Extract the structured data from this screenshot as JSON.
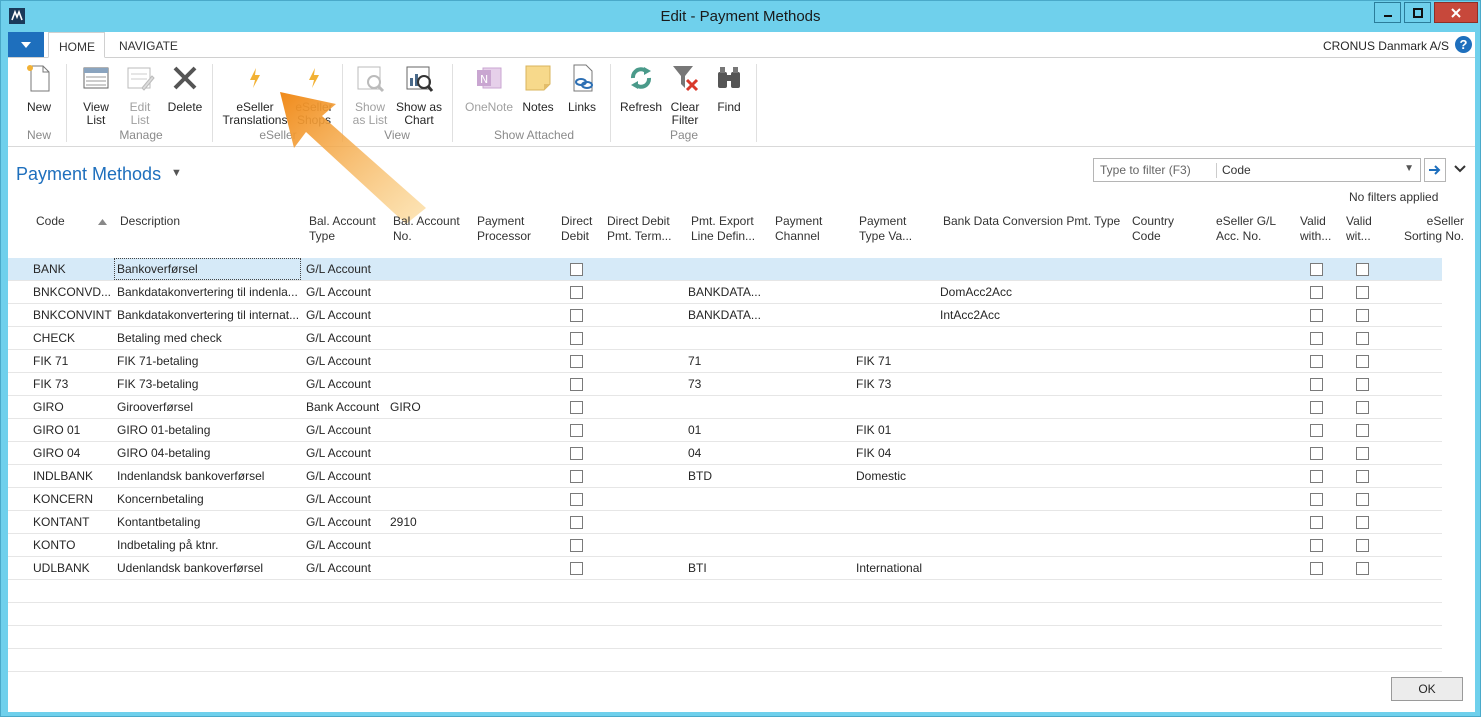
{
  "window": {
    "title": "Edit - Payment Methods"
  },
  "ribbon_tabs": {
    "home": "HOME",
    "navigate": "NAVIGATE"
  },
  "company": "CRONUS Danmark A/S",
  "help": "?",
  "ribbon": {
    "new": "New",
    "view_list": [
      "View",
      "List"
    ],
    "edit_list": [
      "Edit",
      "List"
    ],
    "delete": "Delete",
    "eseller_translations": [
      "eSeller",
      "Translations"
    ],
    "eseller_shops": [
      "eSeller",
      "Shops"
    ],
    "show_as_list": [
      "Show",
      "as List"
    ],
    "show_as_chart": [
      "Show as",
      "Chart"
    ],
    "onenote": "OneNote",
    "notes": "Notes",
    "links": "Links",
    "refresh": "Refresh",
    "clear_filter": [
      "Clear",
      "Filter"
    ],
    "find": "Find",
    "groups": {
      "new": "New",
      "manage": "Manage",
      "eseller": "eSeller",
      "view": "View",
      "show_attached": "Show Attached",
      "page": "Page"
    }
  },
  "page": {
    "title": "Payment Methods",
    "filter_placeholder": "Type to filter (F3)",
    "filter_field": "Code",
    "no_filters": "No filters applied"
  },
  "columns": {
    "code": "Code",
    "description": "Description",
    "bal_acc_type": [
      "Bal. Account",
      "Type"
    ],
    "bal_acc_no": [
      "Bal. Account",
      "No."
    ],
    "payment_processor": [
      "Payment",
      "Processor"
    ],
    "direct_debit": [
      "Direct",
      "Debit"
    ],
    "dd_pmt_term": [
      "Direct Debit",
      "Pmt. Term..."
    ],
    "pmt_export": [
      "Pmt. Export",
      "Line Defin..."
    ],
    "payment_channel": [
      "Payment",
      "Channel"
    ],
    "payment_type_va": [
      "Payment",
      "Type Va..."
    ],
    "bank_data_conv": "Bank Data Conversion Pmt. Type",
    "country_code": [
      "Country",
      "Code"
    ],
    "eseller_gl": [
      "eSeller G/L",
      "Acc. No."
    ],
    "valid_with1": [
      "Valid",
      "with..."
    ],
    "valid_with2": [
      "Valid",
      "wit..."
    ],
    "eseller_sorting": [
      "eSeller",
      "Sorting No."
    ]
  },
  "rows": [
    {
      "code": "BANK",
      "description": "Bankoverførsel",
      "type": "G/L Account",
      "no": "",
      "export": "",
      "ptype": "",
      "conv": ""
    },
    {
      "code": "BNKCONVD...",
      "description": "Bankdatakonvertering til indenla...",
      "type": "G/L Account",
      "no": "",
      "export": "BANKDATA...",
      "ptype": "",
      "conv": "DomAcc2Acc"
    },
    {
      "code": "BNKCONVINT",
      "description": "Bankdatakonvertering til internat...",
      "type": "G/L Account",
      "no": "",
      "export": "BANKDATA...",
      "ptype": "",
      "conv": "IntAcc2Acc"
    },
    {
      "code": "CHECK",
      "description": "Betaling med check",
      "type": "G/L Account",
      "no": "",
      "export": "",
      "ptype": "",
      "conv": ""
    },
    {
      "code": "FIK 71",
      "description": "FIK 71-betaling",
      "type": "G/L Account",
      "no": "",
      "export": "71",
      "ptype": "FIK 71",
      "conv": ""
    },
    {
      "code": "FIK 73",
      "description": "FIK 73-betaling",
      "type": "G/L Account",
      "no": "",
      "export": "73",
      "ptype": "FIK 73",
      "conv": ""
    },
    {
      "code": "GIRO",
      "description": "Girooverførsel",
      "type": "Bank Account",
      "no": "GIRO",
      "export": "",
      "ptype": "",
      "conv": ""
    },
    {
      "code": "GIRO 01",
      "description": "GIRO 01-betaling",
      "type": "G/L Account",
      "no": "",
      "export": "01",
      "ptype": "FIK 01",
      "conv": ""
    },
    {
      "code": "GIRO 04",
      "description": "GIRO 04-betaling",
      "type": "G/L Account",
      "no": "",
      "export": "04",
      "ptype": "FIK 04",
      "conv": ""
    },
    {
      "code": "INDLBANK",
      "description": "Indenlandsk bankoverførsel",
      "type": "G/L Account",
      "no": "",
      "export": "BTD",
      "ptype": "Domestic",
      "conv": ""
    },
    {
      "code": "KONCERN",
      "description": "Koncernbetaling",
      "type": "G/L Account",
      "no": "",
      "export": "",
      "ptype": "",
      "conv": ""
    },
    {
      "code": "KONTANT",
      "description": "Kontantbetaling",
      "type": "G/L Account",
      "no": "2910",
      "export": "",
      "ptype": "",
      "conv": ""
    },
    {
      "code": "KONTO",
      "description": "Indbetaling på ktnr.",
      "type": "G/L Account",
      "no": "",
      "export": "",
      "ptype": "",
      "conv": ""
    },
    {
      "code": "UDLBANK",
      "description": "Udenlandsk bankoverførsel",
      "type": "G/L Account",
      "no": "",
      "export": "BTI",
      "ptype": "International",
      "conv": ""
    }
  ],
  "ok": "OK",
  "colors": {
    "accent": "#1e6fbd",
    "frame": "#6fd0ec",
    "selection": "#d6eaf8",
    "arrow": "#f5a623"
  }
}
